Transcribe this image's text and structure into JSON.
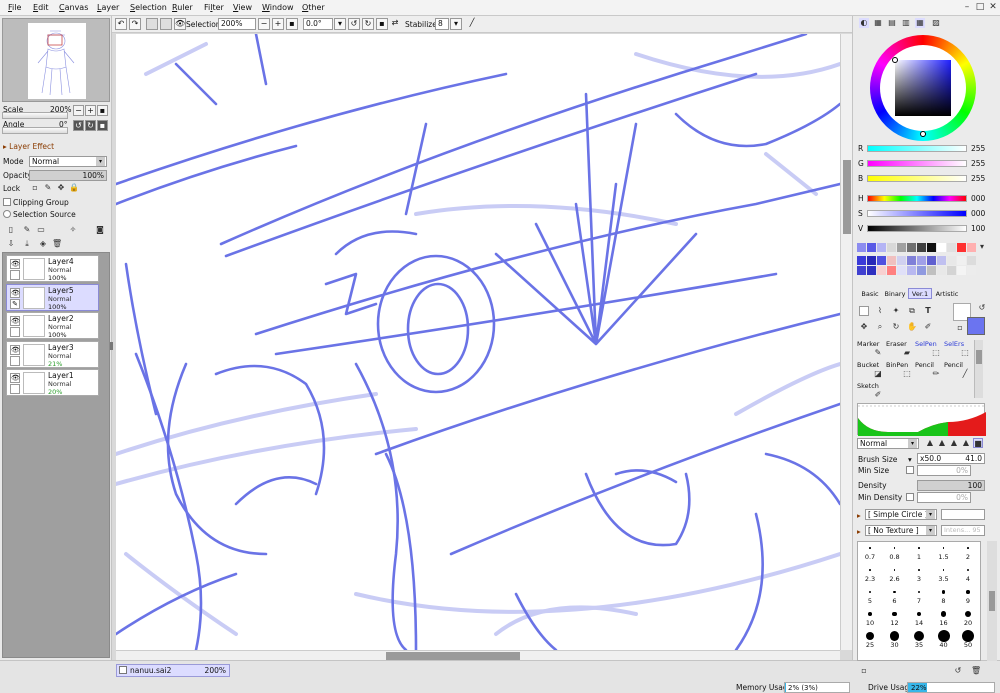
{
  "menu": {
    "items": [
      {
        "pre": "",
        "u": "F",
        "post": "ile"
      },
      {
        "pre": "",
        "u": "E",
        "post": "dit"
      },
      {
        "pre": "",
        "u": "C",
        "post": "anvas"
      },
      {
        "pre": "",
        "u": "L",
        "post": "ayer"
      },
      {
        "pre": "",
        "u": "S",
        "post": "election"
      },
      {
        "pre": "",
        "u": "R",
        "post": "uler"
      },
      {
        "pre": "Fi",
        "u": "l",
        "post": "ter"
      },
      {
        "pre": "",
        "u": "V",
        "post": "iew"
      },
      {
        "pre": "",
        "u": "W",
        "post": "indow"
      },
      {
        "pre": "",
        "u": "O",
        "post": "ther"
      }
    ]
  },
  "navigator": {
    "scale_label": "Scale",
    "scale_value": "200%",
    "angle_label": "Angle",
    "angle_value": "0°"
  },
  "layer_panel": {
    "effect_label": "Layer Effect",
    "mode_label": "Mode",
    "mode_value": "Normal",
    "opacity_label": "Opacity",
    "opacity_value": "100%",
    "opacity_level": 1.0,
    "lock_label": "Lock",
    "clipping_label": "Clipping Group",
    "selection_source_label": "Selection Source",
    "layers": [
      {
        "name": "Layer4",
        "mode": "Normal",
        "opacity": "100%",
        "selected": false,
        "opacity_color": "#111111"
      },
      {
        "name": "Layer5",
        "mode": "Normal",
        "opacity": "100%",
        "selected": true,
        "opacity_color": "#111111"
      },
      {
        "name": "Layer2",
        "mode": "Normal",
        "opacity": "100%",
        "selected": false,
        "opacity_color": "#111111"
      },
      {
        "name": "Layer3",
        "mode": "Normal",
        "opacity": "21%",
        "selected": false,
        "opacity_color": "#2a9d2a"
      },
      {
        "name": "Layer1",
        "mode": "Normal",
        "opacity": "20%",
        "selected": false,
        "opacity_color": "#2a9d2a"
      }
    ]
  },
  "toolbar": {
    "selection_label": "Selection",
    "zoom_value": "200%",
    "rotation_value": "0.0°",
    "stabilizer_label": "Stabilizer",
    "stabilizer_value": "8"
  },
  "status": {
    "doc_name": "nanuu.sai2",
    "doc_zoom": "200%",
    "memory_label": "Memory Usage",
    "memory_value": "2% (3%)",
    "memory_level": 0.02,
    "drive_label": "Drive Usage",
    "drive_value": "22%",
    "drive_level": 0.22
  },
  "color_panel": {
    "r_label": "R",
    "r_value": "255",
    "g_label": "G",
    "g_value": "255",
    "b_label": "B",
    "b_value": "255",
    "h_label": "H",
    "h_value": "000",
    "s_label": "S",
    "s_value": "000",
    "v_label": "V",
    "v_value": "100",
    "accent": "#6b74f0"
  },
  "tool_tabs": [
    "Basic",
    "Binary",
    "Ver.1",
    "Artistic"
  ],
  "active_tool_tab": "Ver.1",
  "tools": [
    {
      "name": "Marker",
      "color": "#111111"
    },
    {
      "name": "Eraser",
      "color": "#111111"
    },
    {
      "name": "SelPen",
      "color": "#2b3ad6"
    },
    {
      "name": "SelErs",
      "color": "#2b3ad6"
    },
    {
      "name": "Bucket",
      "color": "#111111"
    },
    {
      "name": "BinPen",
      "color": "#111111"
    },
    {
      "name": "Pencil",
      "color": "#111111"
    },
    {
      "name": "Pencil",
      "color": "#111111"
    },
    {
      "name": "Sketch",
      "color": "#111111"
    }
  ],
  "brush": {
    "mode_value": "Normal",
    "size_label": "Brush Size",
    "size_mult": "x50.0",
    "size_value": "41.0",
    "min_size_label": "Min Size",
    "min_size_value": "0%",
    "density_label": "Density",
    "density_value": "100",
    "min_density_label": "Min Density",
    "min_density_value": "0%",
    "shape_value": "[ Simple Circle ]",
    "texture_value": "[ No Texture ]",
    "texture_strength": "Intens... 95"
  },
  "brush_sizes": [
    "0.7",
    "0.8",
    "1",
    "1.5",
    "2",
    "2.3",
    "2.6",
    "3",
    "3.5",
    "4",
    "5",
    "6",
    "7",
    "8",
    "9",
    "10",
    "12",
    "14",
    "16",
    "20",
    "25",
    "30",
    "35",
    "40",
    "50"
  ]
}
